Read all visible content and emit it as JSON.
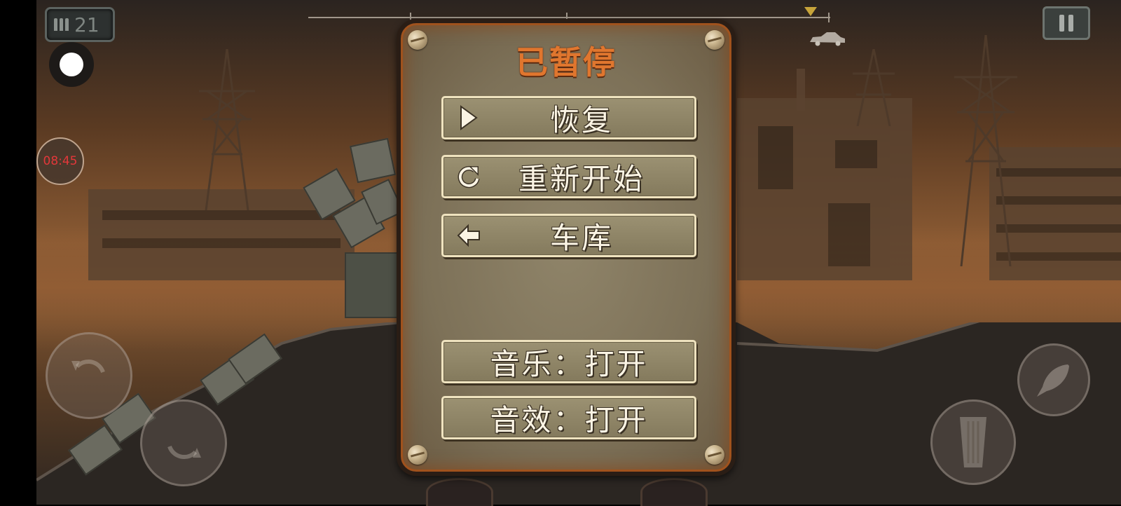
{
  "hud": {
    "ammo_count": "21",
    "timer": "08:45",
    "ammo_icon": "bullets-icon",
    "pause_icon": "pause-icon",
    "record_icon": "record-dot-icon",
    "progress_icon": "car-icon"
  },
  "pause_menu": {
    "title": "已暂停",
    "buttons": [
      {
        "label": "恢复",
        "icon": "play-icon"
      },
      {
        "label": "重新开始",
        "icon": "restart-icon"
      },
      {
        "label": "车库",
        "icon": "back-arrow-icon"
      }
    ],
    "toggles": [
      {
        "label": "音乐：打开"
      },
      {
        "label": "音效：打开"
      }
    ]
  },
  "controls": {
    "left_icons": [
      "rotate-left-icon",
      "rotate-right-icon"
    ],
    "right_icons": [
      "rocket-icon",
      "gas-pedal-icon"
    ]
  },
  "colors": {
    "title": "#e0762e",
    "timer_text": "#e3373a",
    "panel_border": "#a0521d",
    "button_text": "#fbf4e4"
  }
}
